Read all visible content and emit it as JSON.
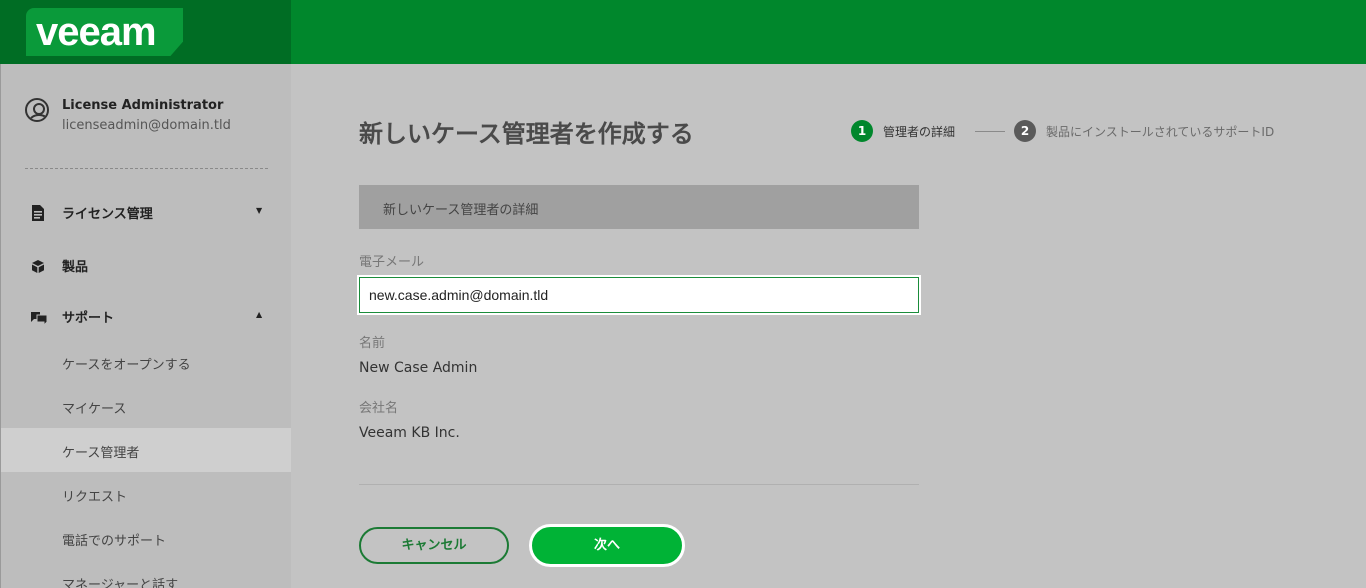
{
  "app": {
    "logo_text": "veeam"
  },
  "user": {
    "name": "License Administrator",
    "email": "licenseadmin@domain.tld"
  },
  "sidebar": {
    "items": [
      {
        "label": "ライセンス管理",
        "icon": "document-icon",
        "arrow": "▼"
      },
      {
        "label": "製品",
        "icon": "cube-icon",
        "arrow": ""
      },
      {
        "label": "サポート",
        "icon": "chat-icon",
        "arrow": "▲"
      }
    ],
    "support_sub_items": [
      {
        "label": "ケースをオープンする",
        "active": false
      },
      {
        "label": "マイケース",
        "active": false
      },
      {
        "label": "ケース管理者",
        "active": true
      },
      {
        "label": "リクエスト",
        "active": false
      },
      {
        "label": "電話でのサポート",
        "active": false
      },
      {
        "label": "マネージャーと話す",
        "active": false
      }
    ]
  },
  "main": {
    "title": "新しいケース管理者を作成する",
    "steps": [
      {
        "number": "1",
        "label": "管理者の詳細",
        "active": true
      },
      {
        "number": "2",
        "label": "製品にインストールされているサポートID",
        "active": false
      }
    ],
    "section_header": "新しいケース管理者の詳細",
    "fields": {
      "email_label": "電子メール",
      "email_value": "new.case.admin@domain.tld",
      "name_label": "名前",
      "name_value": "New Case Admin",
      "company_label": "会社名",
      "company_value": "Veeam KB Inc."
    },
    "buttons": {
      "cancel": "キャンセル",
      "next": "次へ"
    }
  },
  "colors": {
    "header_green": "#00872c",
    "logo_dark_green": "#006d24",
    "accent_green": "#00b336"
  }
}
